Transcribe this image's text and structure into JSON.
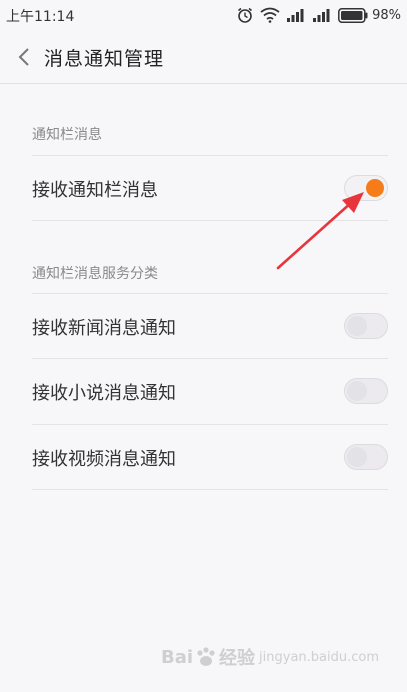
{
  "status_bar": {
    "time": "上午11:14",
    "battery": "98%"
  },
  "header": {
    "title": "消息通知管理"
  },
  "sections": [
    {
      "title": "通知栏消息",
      "items": [
        {
          "label": "接收通知栏消息",
          "enabled": true
        }
      ]
    },
    {
      "title": "通知栏消息服务分类",
      "items": [
        {
          "label": "接收新闻消息通知",
          "enabled": false
        },
        {
          "label": "接收小说消息通知",
          "enabled": false
        },
        {
          "label": "接收视频消息通知",
          "enabled": false
        }
      ]
    }
  ],
  "colors": {
    "accent": "#f57c18",
    "annotation_arrow": "#e8343b",
    "background": "#f7f6f9"
  },
  "watermark": {
    "brand_left": "Bai",
    "brand_right": "经验",
    "sub": "jingyan.baidu.com"
  }
}
